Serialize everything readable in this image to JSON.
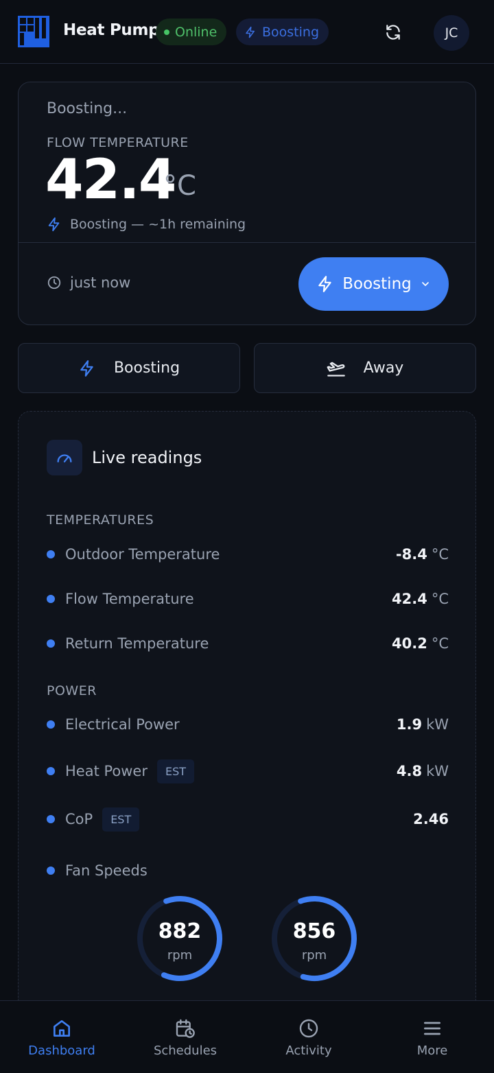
{
  "header": {
    "title": "Heat Pump",
    "online_label": "Online",
    "boost_label": "Boosting",
    "avatar_initials": "JC"
  },
  "status_card": {
    "status": "Boosting...",
    "flow_label": "FLOW TEMPERATURE",
    "flow_value": "42.4",
    "flow_unit": "°C",
    "boost_remaining": "Boosting — ~1h remaining",
    "updated": "just now",
    "boost_button": "Boosting"
  },
  "modes": {
    "boost_label": "Boosting",
    "away_label": "Away"
  },
  "live": {
    "title": "Live readings",
    "temperatures_label": "TEMPERATURES",
    "temperatures": [
      {
        "label": "Outdoor Temperature",
        "value": "-8.4",
        "unit": "°C"
      },
      {
        "label": "Flow Temperature",
        "value": "42.4",
        "unit": "°C"
      },
      {
        "label": "Return Temperature",
        "value": "40.2",
        "unit": "°C"
      }
    ],
    "power_label": "POWER",
    "power": [
      {
        "label": "Electrical Power",
        "value": "1.9",
        "unit": "kW"
      },
      {
        "label": "Heat Power",
        "tag": "EST",
        "value": "4.8",
        "unit": "kW"
      },
      {
        "label": "CoP",
        "tag": "EST",
        "value": "2.46"
      }
    ],
    "fan_label": "Fan Speeds",
    "fans": [
      {
        "value": "882",
        "unit": "rpm",
        "fraction": 0.62
      },
      {
        "value": "856",
        "unit": "rpm",
        "fraction": 0.6
      }
    ]
  },
  "nav": {
    "dashboard": "Dashboard",
    "schedules": "Schedules",
    "activity": "Activity",
    "more": "More"
  },
  "colors": {
    "accent": "#3f7ff2",
    "online": "#47c466",
    "background": "#0b0e14"
  }
}
